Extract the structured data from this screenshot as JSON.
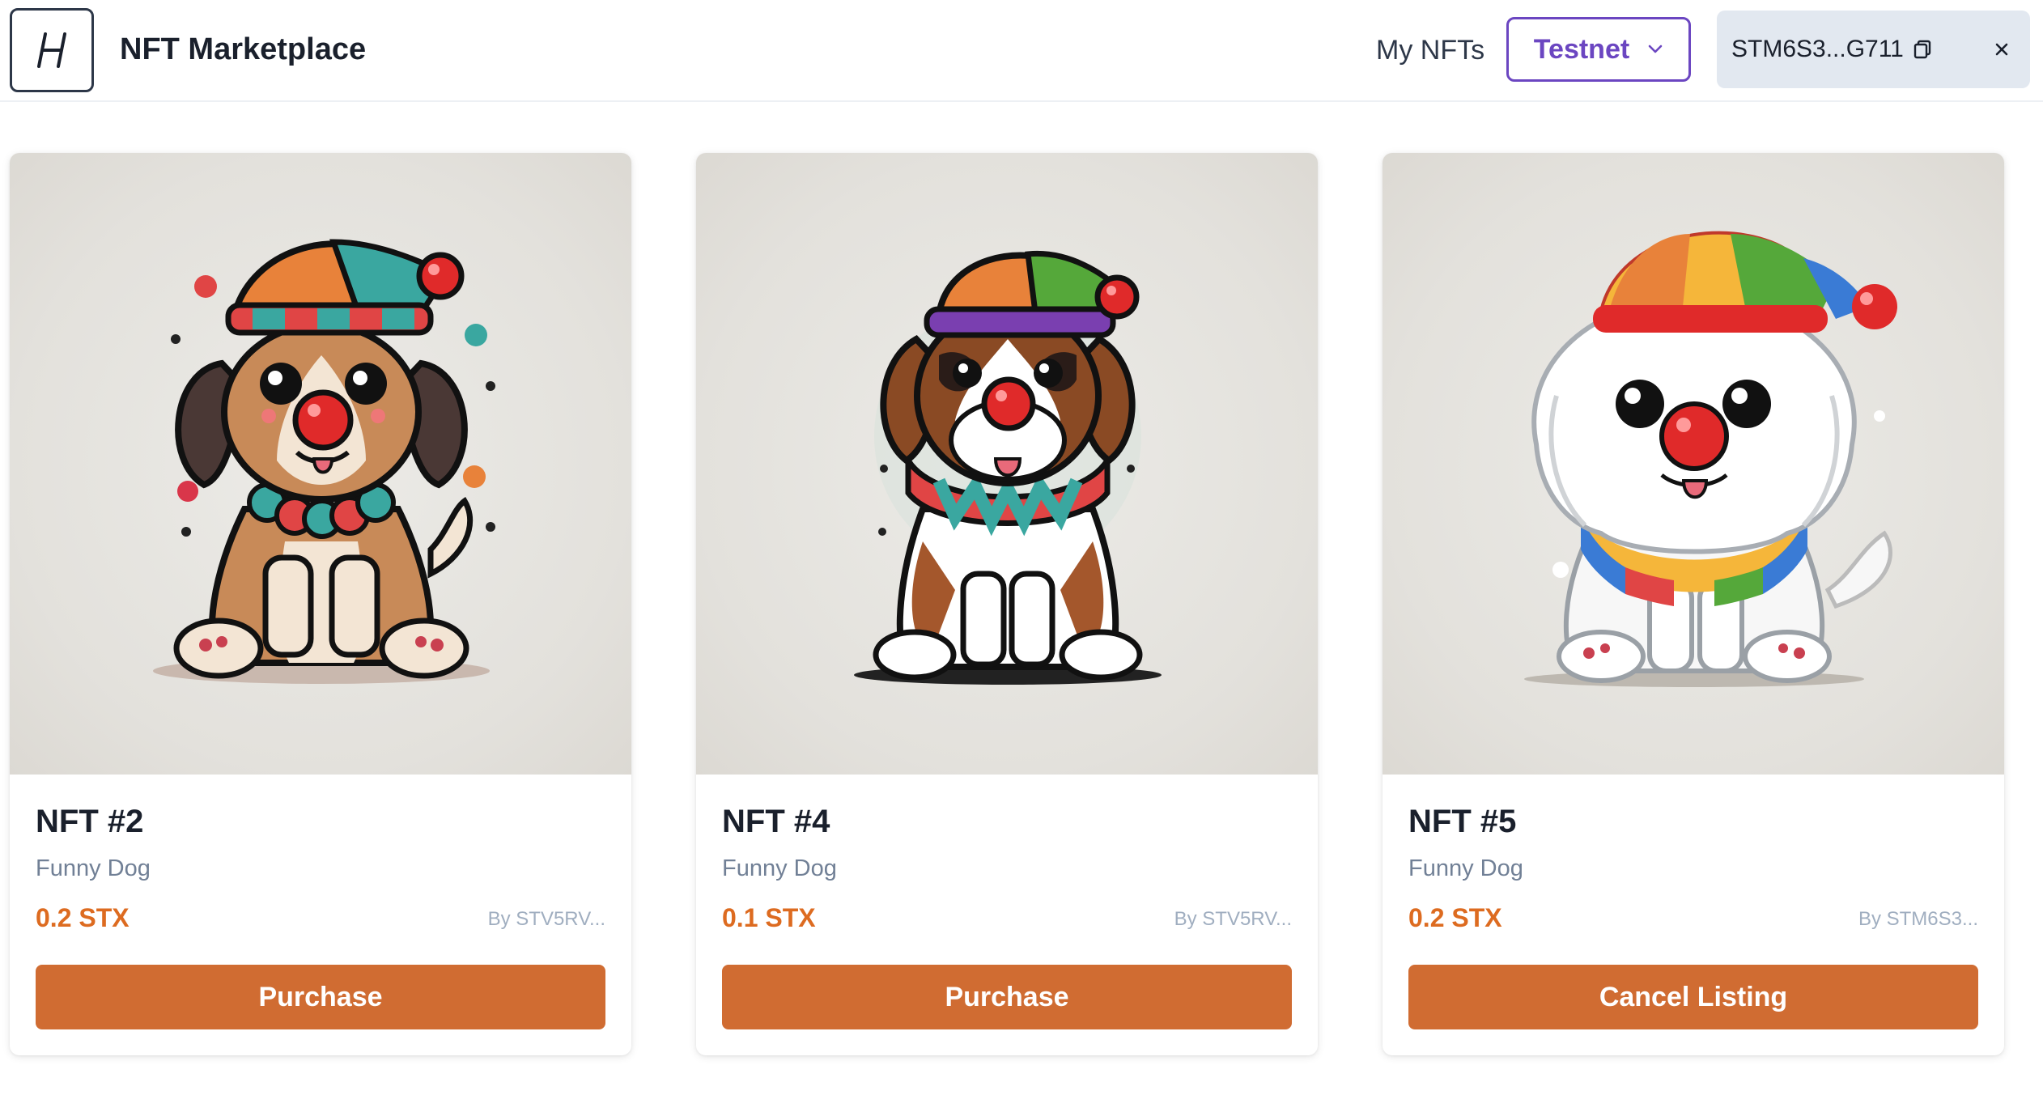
{
  "header": {
    "logo_text": "/-/",
    "app_title": "NFT Marketplace",
    "nav_my_nfts": "My NFTs",
    "network_selector": "Testnet",
    "wallet_address": "STM6S3...G711"
  },
  "colors": {
    "accent_orange": "#dd6b20",
    "button_orange": "#d06c32",
    "network_purple": "#6b46c1",
    "wallet_bg": "#e2e8f0"
  },
  "nfts": [
    {
      "title": "NFT #2",
      "description": "Funny Dog",
      "price": "0.2 STX",
      "seller": "By STV5RV...",
      "action_label": "Purchase",
      "image": "clown-dog-beagle"
    },
    {
      "title": "NFT #4",
      "description": "Funny Dog",
      "price": "0.1 STX",
      "seller": "By STV5RV...",
      "action_label": "Purchase",
      "image": "clown-dog-saint-bernard"
    },
    {
      "title": "NFT #5",
      "description": "Funny Dog",
      "price": "0.2 STX",
      "seller": "By STM6S3...",
      "action_label": "Cancel Listing",
      "image": "clown-dog-white-fluffy"
    }
  ]
}
